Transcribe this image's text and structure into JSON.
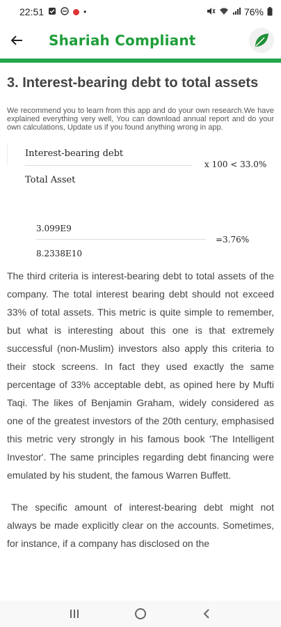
{
  "status": {
    "time": "22:51",
    "battery": "76%"
  },
  "header": {
    "title": "Shariah Compliant"
  },
  "article": {
    "title": "3. Interest-bearing debt to total assets",
    "intro": "We recommend you to learn from this app and do your own research.We have explained everything very well, You can download annual report and do your own calculations, Update us if you found anything wrong in app.",
    "formula": {
      "numerator": "Interest-bearing debt",
      "denominator": "Total Asset",
      "right": "x 100 < 33.0%"
    },
    "calc": {
      "numerator": "3.099E9",
      "denominator": "8.2338E10",
      "result": "=3.76%"
    },
    "paragraph1": "The third criteria is interest-bearing debt to total assets of the company. The total interest bearing debt should not exceed 33% of total assets. This metric is quite simple to remember, but what is interesting about this one is that extremely successful (non-Muslim) investors also apply this criteria to their stock screens. In fact they used exactly the same percentage of 33% acceptable debt, as opined here by Mufti Taqi. The likes of Benjamin Graham, widely considered as one of the greatest investors of the 20th century, emphasised this metric very strongly in his famous book 'The Intelligent Investor'. The same principles regarding debt financing were emulated by his student, the famous Warren Buffett.",
    "paragraph2": "The specific amount of interest-bearing debt might not always be made explicitly clear on the accounts. Sometimes, for instance, if a company has disclosed on the"
  },
  "colors": {
    "brand_green": "#22a84a",
    "title_green": "#1e9e3a"
  }
}
